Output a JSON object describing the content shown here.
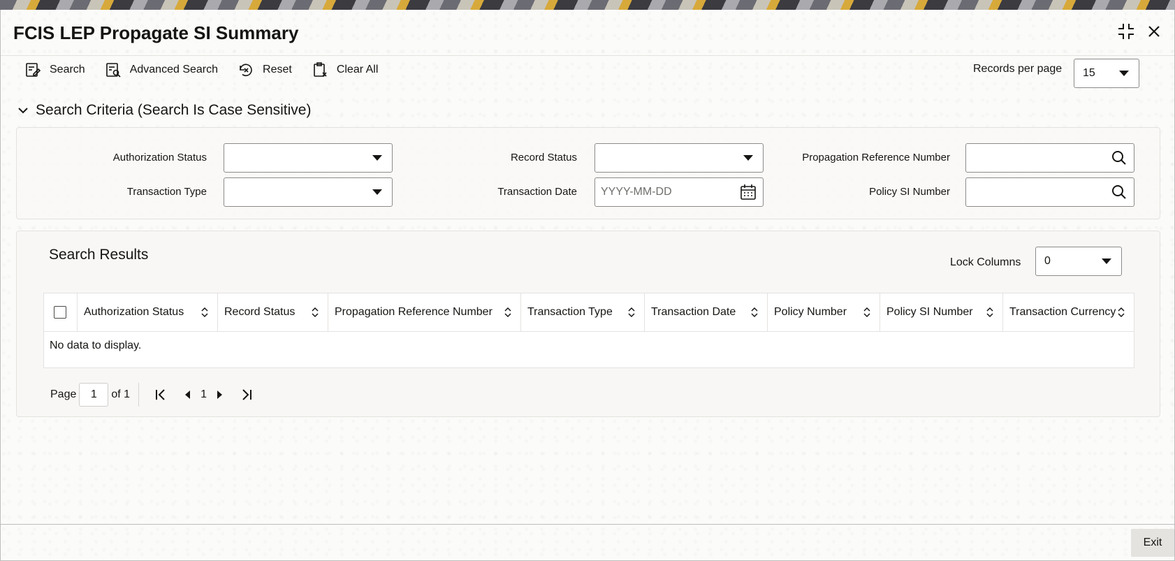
{
  "window": {
    "title": "FCIS LEP Propagate SI Summary"
  },
  "toolbar": {
    "search": "Search",
    "advanced_search": "Advanced Search",
    "reset": "Reset",
    "clear_all": "Clear All"
  },
  "records_per_page": {
    "label": "Records per page",
    "value": "15"
  },
  "criteria": {
    "heading": "Search Criteria (Search Is Case Sensitive)",
    "authorization_status": {
      "label": "Authorization Status",
      "value": ""
    },
    "record_status": {
      "label": "Record Status",
      "value": ""
    },
    "propagation_reference_number": {
      "label": "Propagation Reference Number",
      "value": ""
    },
    "transaction_type": {
      "label": "Transaction Type",
      "value": ""
    },
    "transaction_date": {
      "label": "Transaction Date",
      "placeholder": "YYYY-MM-DD",
      "value": ""
    },
    "policy_si_number": {
      "label": "Policy SI Number",
      "value": ""
    }
  },
  "results": {
    "heading": "Search Results",
    "lock_columns": {
      "label": "Lock Columns",
      "value": "0"
    },
    "columns": [
      "Authorization Status",
      "Record Status",
      "Propagation Reference Number",
      "Transaction Type",
      "Transaction Date",
      "Policy Number",
      "Policy SI Number",
      "Transaction Currency"
    ],
    "empty_message": "No data to display."
  },
  "pagination": {
    "page_label": "Page",
    "current_page": "1",
    "of_label": "of 1",
    "page_number": "1"
  },
  "footer": {
    "exit": "Exit"
  },
  "colors": {
    "accent_text": "#161513",
    "border": "#8c8b88",
    "panel_bg": "#f9f8f6"
  }
}
